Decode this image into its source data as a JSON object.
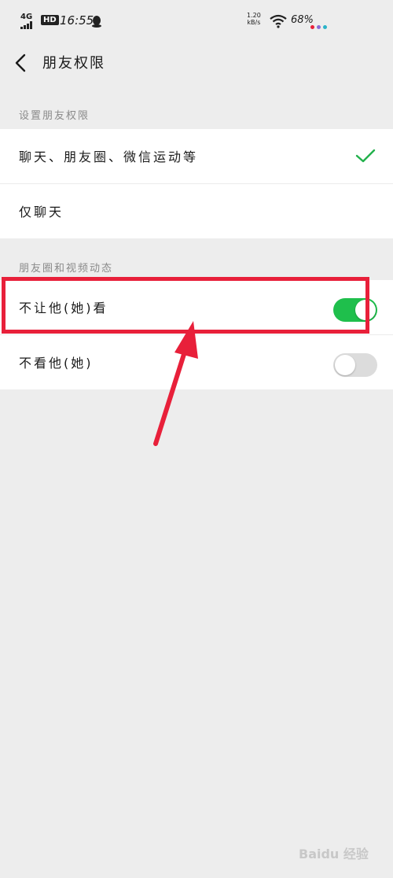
{
  "status_bar": {
    "network": "4G",
    "hd": "HD",
    "time": "16:55",
    "speed_value": "1.20",
    "speed_unit": "kB/s",
    "battery": "68%",
    "dot_colors": [
      "#e8203a",
      "#8a6ad6",
      "#2ab3c8"
    ]
  },
  "nav": {
    "title": "朋友权限",
    "back_icon": "chevron-left-icon"
  },
  "permissions": {
    "section_label": "设置朋友权限",
    "options": [
      {
        "label": "聊天、朋友圈、微信运动等",
        "selected": true
      },
      {
        "label": "仅聊天",
        "selected": false
      }
    ]
  },
  "moments": {
    "section_label": "朋友圈和视频动态",
    "toggles": [
      {
        "label": "不让他(她)看",
        "on": true
      },
      {
        "label": "不看他(她)",
        "on": false
      }
    ]
  },
  "colors": {
    "accent": "#1fbf4c",
    "check": "#22b14c",
    "highlight": "#e8203a"
  },
  "watermark": "Baidu 经验"
}
